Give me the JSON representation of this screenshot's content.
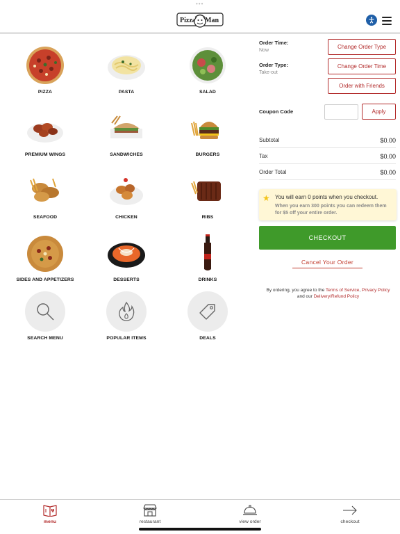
{
  "header": {
    "logo_text": "Pizza Man"
  },
  "categories": [
    {
      "label": "PIZZA",
      "icon": "pizza-image"
    },
    {
      "label": "PASTA",
      "icon": "pasta-image"
    },
    {
      "label": "SALAD",
      "icon": "salad-image"
    },
    {
      "label": "PREMIUM WINGS",
      "icon": "wings-image"
    },
    {
      "label": "SANDWICHES",
      "icon": "sandwich-image"
    },
    {
      "label": "BURGERS",
      "icon": "burger-image"
    },
    {
      "label": "SEAFOOD",
      "icon": "seafood-image"
    },
    {
      "label": "CHICKEN",
      "icon": "chicken-image"
    },
    {
      "label": "RIBS",
      "icon": "ribs-image"
    },
    {
      "label": "SIDES AND APPETIZERS",
      "icon": "sides-image"
    },
    {
      "label": "DESSERTS",
      "icon": "dessert-image"
    },
    {
      "label": "DRINKS",
      "icon": "drink-image"
    },
    {
      "label": "SEARCH MENU",
      "icon": "search-icon"
    },
    {
      "label": "POPULAR ITEMS",
      "icon": "flame-icon"
    },
    {
      "label": "DEALS",
      "icon": "tag-icon"
    }
  ],
  "order": {
    "time_label": "Order Time:",
    "time_value": "Now",
    "type_label": "Order Type:",
    "type_value": "Take-out",
    "change_type_btn": "Change Order Type",
    "change_time_btn": "Change Order Time",
    "order_friends_btn": "Order with Friends",
    "coupon_label": "Coupon Code",
    "coupon_value": "",
    "apply_btn": "Apply",
    "subtotal_label": "Subtotal",
    "subtotal_value": "$0.00",
    "tax_label": "Tax",
    "tax_value": "$0.00",
    "total_label": "Order Total",
    "total_value": "$0.00",
    "points_line1": "You will earn 0 points when you checkout.",
    "points_line2": "When you earn 300 points you can redeem them for $5 off your entire order.",
    "checkout_btn": "CHECKOUT",
    "cancel_link": "Cancel Your Order",
    "terms_prefix": "By ordering, you agree to the ",
    "terms_link": "Terms of Service",
    "terms_comma": ", ",
    "privacy_link": "Privacy Policy",
    "terms_and": " and our ",
    "refund_link": "Delivery/Refund Policy"
  },
  "bottom_nav": [
    {
      "label": "menu",
      "icon": "menu-book-icon",
      "active": true
    },
    {
      "label": "restaurant",
      "icon": "storefront-icon",
      "active": false
    },
    {
      "label": "view order",
      "icon": "cloche-icon",
      "active": false
    },
    {
      "label": "checkout",
      "icon": "arrow-right-icon",
      "active": false
    }
  ],
  "colors": {
    "accent": "#b22a2a",
    "checkout_green": "#3f9a2a",
    "points_bg": "#fff7d6",
    "accessibility_blue": "#1f5fa8"
  }
}
